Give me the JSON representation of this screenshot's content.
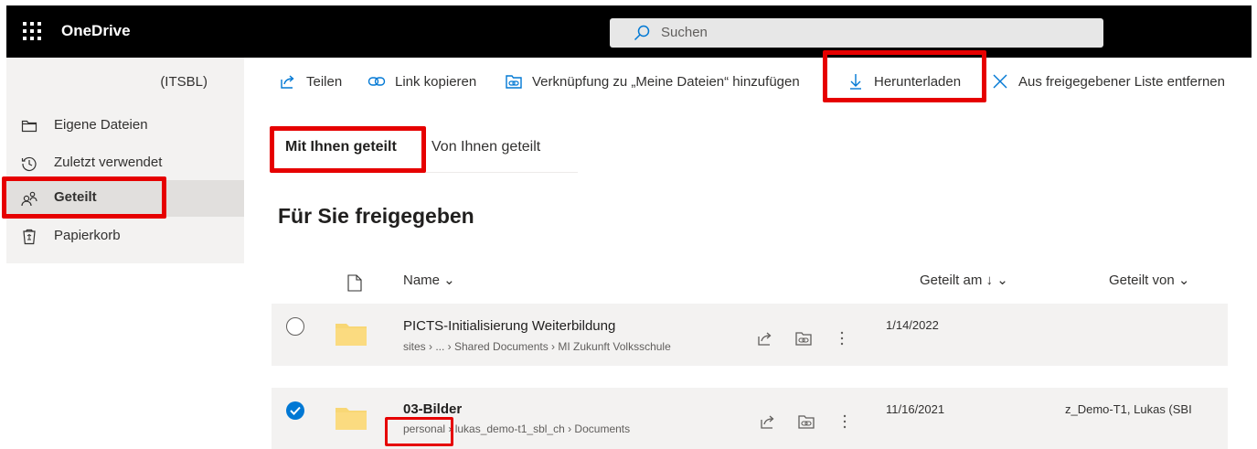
{
  "app": {
    "name": "OneDrive",
    "search_placeholder": "Suchen"
  },
  "sidebar": {
    "tenant": "(ITSBL)",
    "items": [
      {
        "label": "Eigene Dateien",
        "icon": "folder-icon"
      },
      {
        "label": "Zuletzt verwendet",
        "icon": "history-icon"
      },
      {
        "label": "Geteilt",
        "icon": "shared-icon",
        "selected": true
      },
      {
        "label": "Papierkorb",
        "icon": "recycle-bin-icon"
      }
    ]
  },
  "commandbar": {
    "share": "Teilen",
    "copy_link": "Link kopieren",
    "add_shortcut": "Verknüpfung zu „Meine Dateien“ hinzufügen",
    "download": "Herunterladen",
    "remove_from_shared": "Aus freigegebener Liste entfernen"
  },
  "tabs": {
    "shared_with_you": "Mit Ihnen geteilt",
    "shared_by_you": "Von Ihnen geteilt"
  },
  "section_title": "Für Sie freigegeben",
  "columns": {
    "name": "Name ⌄",
    "shared_on": "Geteilt am ↓ ⌄",
    "shared_by": "Geteilt von ⌄"
  },
  "files": [
    {
      "name": "PICTS-Initialisierung Weiterbildung",
      "path": "sites › ... › Shared Documents › MI Zukunft Volksschule",
      "shared_on": "1/14/2022",
      "shared_by": "",
      "selected": false
    },
    {
      "name": "03-Bilder",
      "path": "personal › lukas_demo-t1_sbl_ch › Documents",
      "shared_on": "11/16/2021",
      "shared_by": "z_Demo-T1, Lukas (SBI",
      "selected": true
    }
  ],
  "colors": {
    "accent": "#0078d4",
    "topbar": "#000000",
    "highlight_box": "#e60000",
    "folder": "#f8d775"
  }
}
